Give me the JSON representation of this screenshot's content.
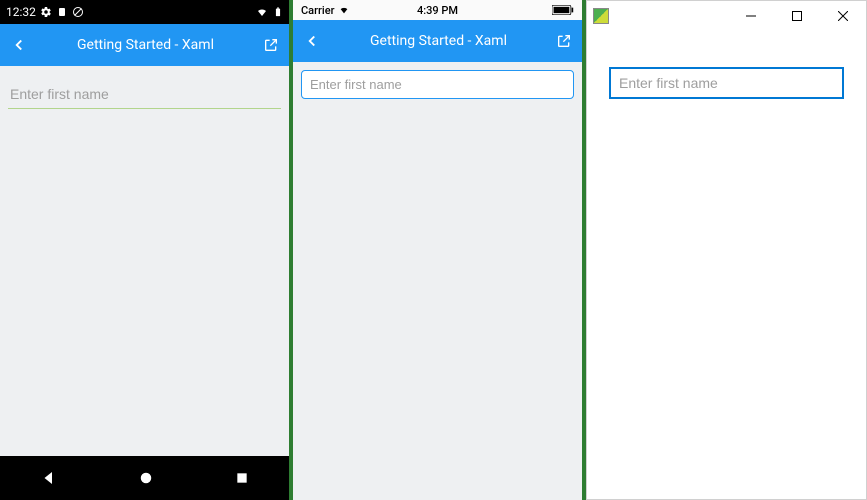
{
  "android": {
    "statusbar": {
      "time": "12:32"
    },
    "topbar": {
      "title": "Getting Started - Xaml"
    },
    "input": {
      "placeholder": "Enter first name",
      "value": ""
    }
  },
  "ios": {
    "statusbar": {
      "carrier": "Carrier",
      "time": "4:39 PM"
    },
    "topbar": {
      "title": "Getting Started - Xaml"
    },
    "input": {
      "placeholder": "Enter first name",
      "value": ""
    }
  },
  "windows": {
    "input": {
      "placeholder": "Enter first name",
      "value": ""
    }
  }
}
